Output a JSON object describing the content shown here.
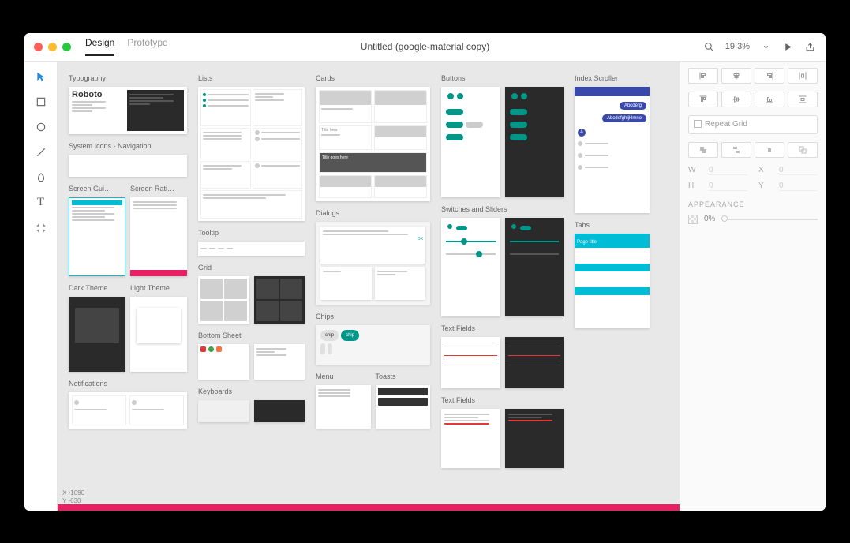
{
  "titlebar": {
    "traffic_colors": [
      "#ff5f57",
      "#febc2e",
      "#28c840"
    ],
    "tabs": {
      "design": "Design",
      "prototype": "Prototype"
    },
    "doc_title": "Untitled (google-material copy)",
    "zoom": "19.3%"
  },
  "tools": [
    "select",
    "rectangle",
    "ellipse",
    "line",
    "pen",
    "text",
    "artboard"
  ],
  "coords": {
    "x_label": "X",
    "x": "-1090",
    "y_label": "Y",
    "y": "-630"
  },
  "artboards": {
    "col1": {
      "typography": "Typography",
      "system_icons": "System Icons - Navigation",
      "screen_guide": "Screen Gui…",
      "screen_ratio": "Screen Rati…",
      "dark_theme": "Dark Theme",
      "light_theme": "Light Theme",
      "notifications": "Notifications"
    },
    "col2": {
      "lists": "Lists",
      "tooltip": "Tooltip",
      "grid": "Grid",
      "bottom_sheet": "Bottom Sheet",
      "keyboards": "Keyboards"
    },
    "col3": {
      "cards": "Cards",
      "dialogs": "Dialogs",
      "chips": "Chips",
      "menu": "Menu",
      "toasts": "Toasts"
    },
    "col4": {
      "buttons": "Buttons",
      "switches": "Switches and Sliders",
      "text_fields": "Text Fields",
      "text_fields2": "Text Fields"
    },
    "col5": {
      "index_scroller": "Index Scroller",
      "tabs": "Tabs"
    }
  },
  "artboard_text": {
    "roboto": "Roboto",
    "title_here": "Title here",
    "title_goes_here": "Title goes here",
    "abcdefg": "Abcdefg",
    "abcdefghijklmno": "Abcdefghijklmno",
    "page_title": "Page title"
  },
  "inspector": {
    "repeat_grid": "Repeat Grid",
    "w_label": "W",
    "w": "0",
    "h_label": "H",
    "h": "0",
    "x_label": "X",
    "x": "0",
    "y_label": "Y",
    "y": "0",
    "appearance": "APPEARANCE",
    "opacity": "0%"
  }
}
